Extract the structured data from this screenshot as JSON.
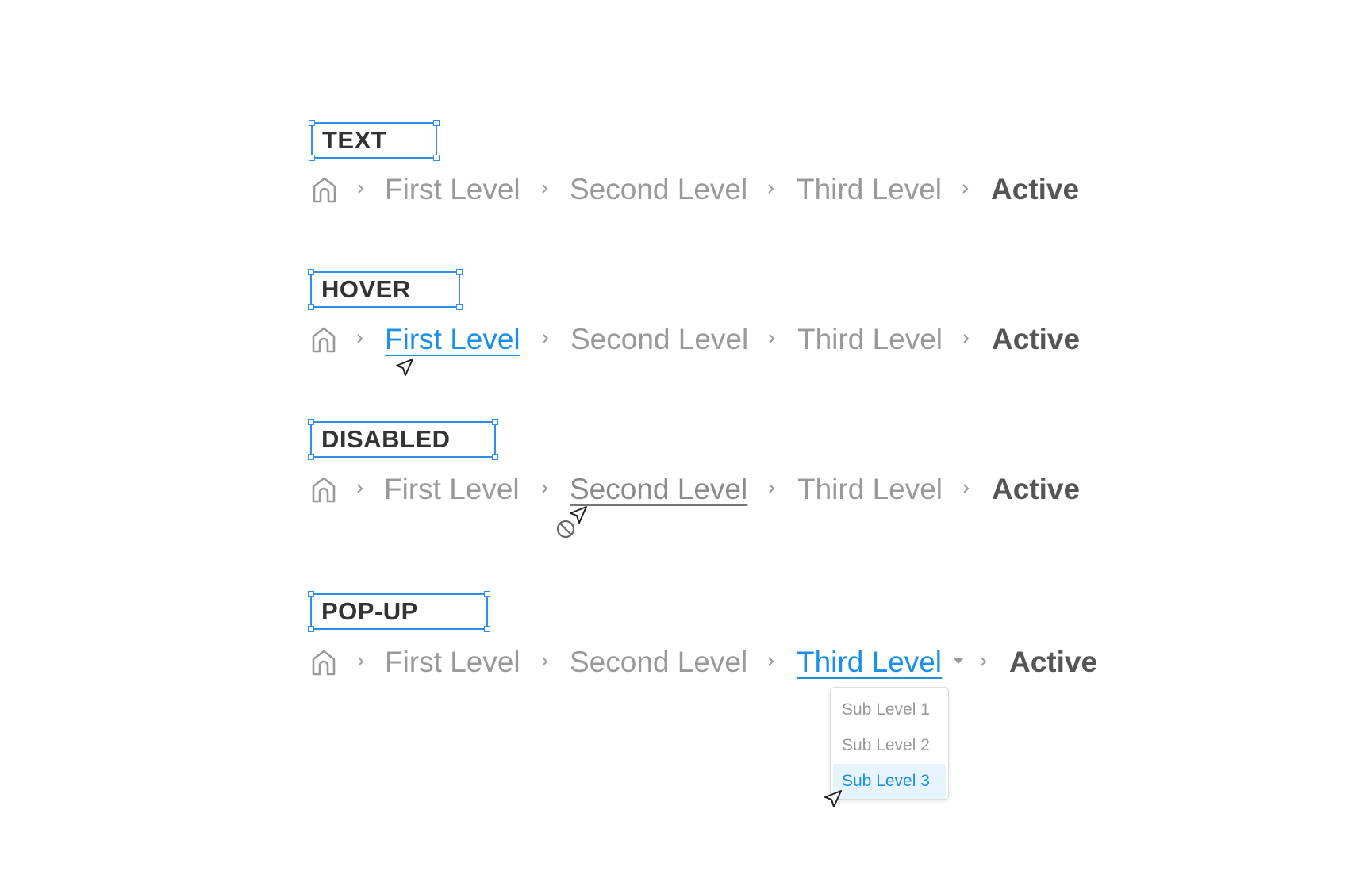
{
  "colors": {
    "accent": "#1b90e8",
    "selection_box": "#2f8fe6",
    "inactive_text": "#999999",
    "active_text": "#555555",
    "label_text": "#333333",
    "dropdown_selected_bg": "#e6f4fe"
  },
  "icons": {
    "home": "home-icon",
    "separator": "chevron-right-icon",
    "cursor": "navigation-arrow-cursor-icon",
    "not_allowed": "not-allowed-icon",
    "caret": "caret-down-icon"
  },
  "sections": [
    {
      "label": "TEXT",
      "crumbs": [
        "First Level",
        "Second Level",
        "Third Level"
      ],
      "active": "Active"
    },
    {
      "label": "HOVER",
      "crumbs": [
        "First Level",
        "Second Level",
        "Third Level"
      ],
      "active": "Active"
    },
    {
      "label": "DISABLED",
      "crumbs": [
        "First Level",
        "Second Level",
        "Third Level"
      ],
      "active": "Active"
    },
    {
      "label": "POP-UP",
      "crumbs": [
        "First Level",
        "Second Level",
        "Third Level"
      ],
      "active": "Active"
    }
  ],
  "popup": {
    "items": [
      "Sub Level 1",
      "Sub Level 2",
      "Sub Level 3"
    ],
    "selected": "Sub Level 3"
  }
}
